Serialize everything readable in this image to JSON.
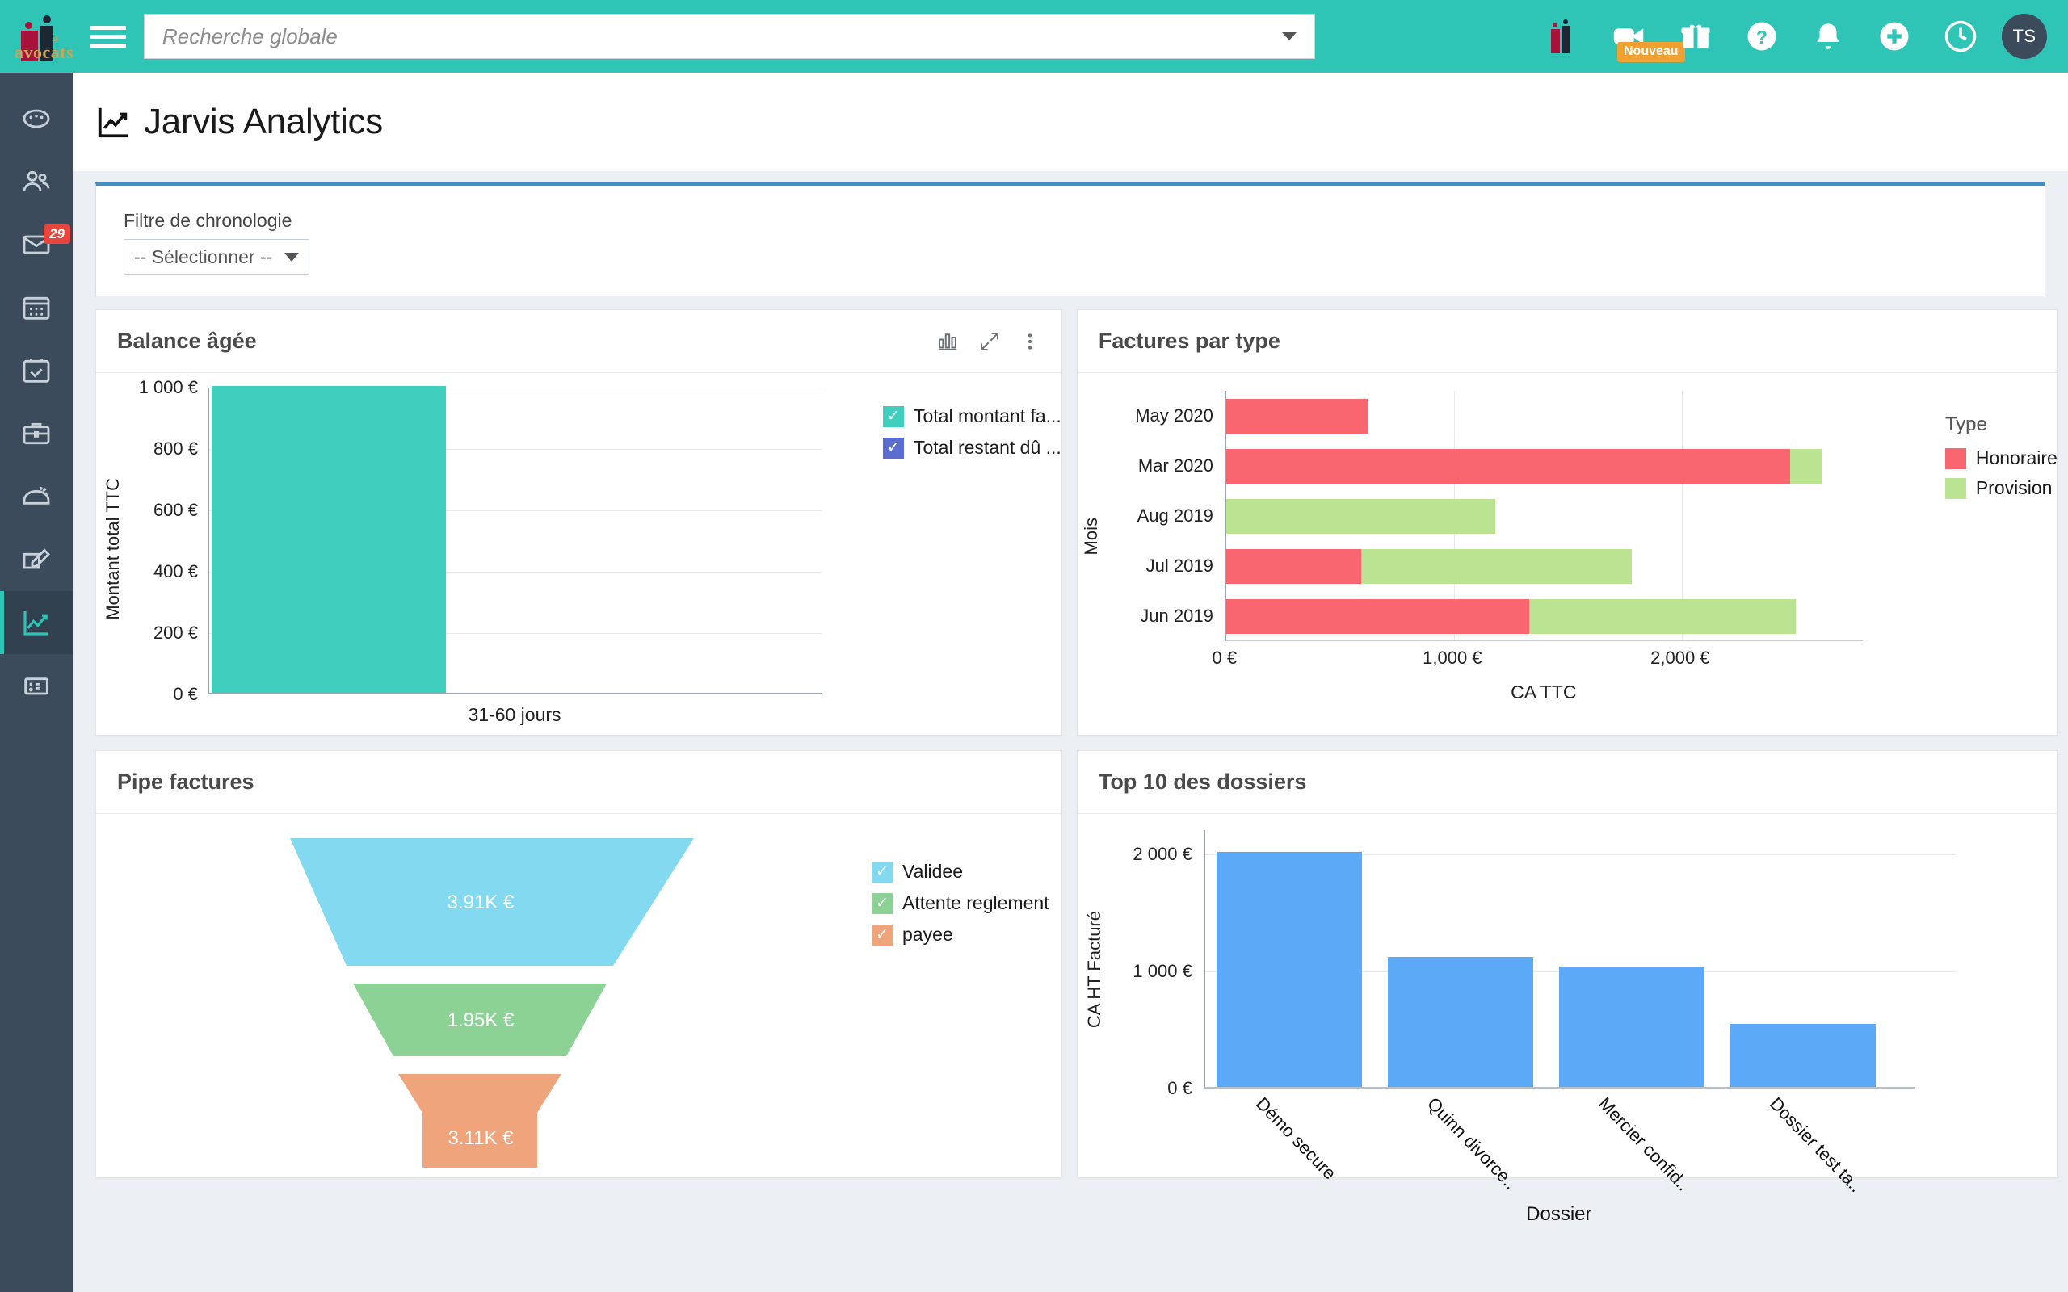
{
  "brand": {
    "logo_word": "avocats",
    "logo_small": "la",
    "header_color": "#2ec4b6",
    "sidebar_color": "#3b4b5c"
  },
  "topbar": {
    "menu_icon": "hamburger-icon",
    "search": {
      "placeholder": "Recherche globale",
      "value": ""
    },
    "icons": [
      {
        "name": "app-logo-icon",
        "label": ""
      },
      {
        "name": "video-camera-icon",
        "label": "",
        "badge": "Nouveau"
      },
      {
        "name": "gift-icon",
        "label": ""
      },
      {
        "name": "help-circle-icon",
        "label": ""
      },
      {
        "name": "bell-icon",
        "label": ""
      },
      {
        "name": "plus-circle-icon",
        "label": ""
      },
      {
        "name": "clock-icon",
        "label": ""
      }
    ],
    "avatar_initials": "TS"
  },
  "sidebar": {
    "items": [
      {
        "name": "dashboard",
        "icon": "gauge-icon",
        "badge": ""
      },
      {
        "name": "contacts",
        "icon": "users-icon",
        "badge": ""
      },
      {
        "name": "messages",
        "icon": "envelope-icon",
        "badge": "29"
      },
      {
        "name": "calendar",
        "icon": "calendar-icon",
        "badge": ""
      },
      {
        "name": "tasks",
        "icon": "calendar-check-icon",
        "badge": ""
      },
      {
        "name": "cases",
        "icon": "briefcase-icon",
        "badge": ""
      },
      {
        "name": "archive",
        "icon": "safe-icon",
        "badge": ""
      },
      {
        "name": "editor",
        "icon": "pencil-square-icon",
        "badge": ""
      },
      {
        "name": "analytics",
        "icon": "chart-line-icon",
        "badge": "",
        "active": true
      },
      {
        "name": "accounting",
        "icon": "calculator-icon",
        "badge": ""
      }
    ]
  },
  "page": {
    "title": "Jarvis Analytics",
    "title_icon": "chart-line-icon"
  },
  "filter": {
    "label": "Filtre de chronologie",
    "selected": "-- Sélectionner --",
    "caret_icon": "chevron-down-icon"
  },
  "cards": {
    "balance": {
      "title": "Balance âgée",
      "actions": [
        {
          "name": "chart-type-icon"
        },
        {
          "name": "expand-icon"
        },
        {
          "name": "more-options-icon"
        }
      ]
    },
    "factures": {
      "title": "Factures par type"
    },
    "pipe": {
      "title": "Pipe factures"
    },
    "top10": {
      "title": "Top 10 des dossiers"
    }
  },
  "chart_data": [
    {
      "id": "balance-agee",
      "type": "bar",
      "title": "Balance âgée",
      "categories": [
        "31-60 jours"
      ],
      "series": [
        {
          "name": "Total montant facturé TTC",
          "values": [
            1000
          ],
          "color": "#40cfbe"
        },
        {
          "name": "Total restant dû TTC",
          "values": [
            0
          ],
          "color": "#5b6ed0"
        }
      ],
      "legend": [
        {
          "label": "Total montant fa...",
          "color": "#40cfbe",
          "checked": true
        },
        {
          "label": "Total restant dû ...",
          "color": "#5b6ed0",
          "checked": true
        }
      ],
      "xlabel": "31-60 jours",
      "ylabel": "Montant total TTC",
      "yticks": [
        "0 €",
        "200 €",
        "400 €",
        "600 €",
        "800 €",
        "1 000 €"
      ],
      "ylim": [
        0,
        1000
      ],
      "grid": true,
      "legend_position": "right"
    },
    {
      "id": "factures-par-type",
      "type": "bar",
      "orientation": "horizontal",
      "stacked": true,
      "title": "Factures par type",
      "categories": [
        "May 2020",
        "Mar 2020",
        "Aug 2019",
        "Jul 2019",
        "Jun 2019"
      ],
      "series": [
        {
          "name": "Honoraire",
          "color": "#fa6670",
          "values": [
            620,
            2475,
            0,
            590,
            1330
          ]
        },
        {
          "name": "Provision",
          "color": "#bae392",
          "values": [
            0,
            140,
            1180,
            1190,
            1170
          ]
        }
      ],
      "legend_title": "Type",
      "legend": [
        {
          "label": "Honoraire",
          "color": "#fa6670"
        },
        {
          "label": "Provision",
          "color": "#bae392"
        }
      ],
      "xlabel": "CA TTC",
      "ylabel": "Mois",
      "xticks": [
        "0 €",
        "1,000 €",
        "2,000 €"
      ],
      "xlim": [
        0,
        2800
      ],
      "grid": true,
      "legend_position": "right"
    },
    {
      "id": "pipe-factures",
      "type": "funnel",
      "title": "Pipe factures",
      "stages": [
        {
          "label": "Validee",
          "value_label": "3.91K €",
          "value": 3910,
          "color": "#83daf0"
        },
        {
          "label": "Attente reglement",
          "value_label": "1.95K €",
          "value": 1950,
          "color": "#8bd294"
        },
        {
          "label": "payee",
          "value_label": "3.11K €",
          "value": 3110,
          "color": "#f0a47c"
        }
      ],
      "legend": [
        {
          "label": "Validee",
          "color": "#83daf0",
          "checked": true
        },
        {
          "label": "Attente reglement",
          "color": "#8bd294",
          "checked": true
        },
        {
          "label": "payee",
          "color": "#f0a47c",
          "checked": true
        }
      ],
      "legend_position": "right"
    },
    {
      "id": "top-10-des-dossiers",
      "type": "bar",
      "title": "Top 10 des dossiers",
      "categories": [
        "Démo secure",
        "Quinn divorce..",
        "Mercier confid..",
        "Dossier test ta.."
      ],
      "values": [
        2010,
        1110,
        1030,
        540
      ],
      "color": "#5ba9f7",
      "xlabel": "Dossier",
      "ylabel": "CA HT Facturé",
      "yticks": [
        "0 €",
        "1 000 €",
        "2 000 €"
      ],
      "ylim": [
        0,
        2200
      ],
      "grid": true
    }
  ]
}
